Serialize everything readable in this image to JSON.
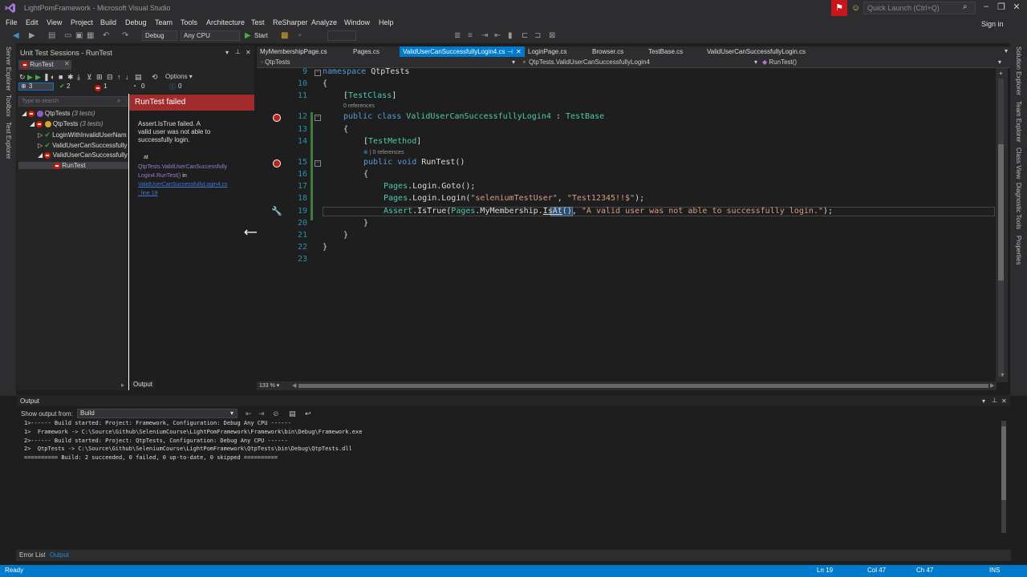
{
  "window": {
    "title": "LightPomFramework - Microsoft Visual Studio",
    "quick_launch_placeholder": "Quick Launch (Ctrl+Q)",
    "sign_in": "Sign in"
  },
  "menu": [
    "File",
    "Edit",
    "View",
    "Project",
    "Build",
    "Debug",
    "Team",
    "Tools",
    "Architecture",
    "Test",
    "ReSharper",
    "Analyze",
    "Window",
    "Help"
  ],
  "toolbar": {
    "configuration": "Debug",
    "platform": "Any CPU",
    "start_label": "Start"
  },
  "left_strip": [
    "Server Explorer",
    "Toolbox",
    "Test Explorer"
  ],
  "right_strip": [
    "Solution Explorer",
    "Team Explorer",
    "Class View",
    "Diagnostic Tools",
    "Properties"
  ],
  "unit_tests": {
    "panel_title": "Unit Test Sessions - RunTest",
    "session_tab": "RunTest",
    "options_label": "Options",
    "counts": {
      "all": "3",
      "passed": "2",
      "failed": "1",
      "ignored": "0",
      "other": "0"
    },
    "filter_placeholder": "Type to search",
    "tree": [
      {
        "label": "QtpTests",
        "suffix": "(3 tests)",
        "status": "fail"
      },
      {
        "label": "QtpTests",
        "suffix": "(3 tests)",
        "status": "fail"
      },
      {
        "label": "LoginWithInvalidUserNam",
        "suffix": "",
        "status": "pass"
      },
      {
        "label": "ValidUserCanSuccessfully",
        "suffix": "",
        "status": "pass"
      },
      {
        "label": "ValidUserCanSuccessfully",
        "suffix": "",
        "status": "fail"
      },
      {
        "label": "RunTest",
        "suffix": "",
        "status": "fail"
      }
    ],
    "detail": {
      "title": "RunTest failed",
      "message": "Assert.IsTrue failed. A\nvalid user was not able to\nsuccessfully login.",
      "at_label": "at",
      "stack_method": "QtpTests.ValidUserCanSuccessfully Login4.RunTest()",
      "stack_in": "in",
      "stack_file": "ValidUserCanSuccessfullyLogin4.cs",
      "stack_line": ": line 19"
    },
    "output_tab": "Output"
  },
  "editor": {
    "tabs": [
      "MyMembershipPage.cs",
      "Pages.cs",
      "ValidUserCanSuccessfullyLogin4.cs",
      "LoginPage.cs",
      "Browser.cs",
      "TestBase.cs",
      "ValidUserCanSuccessfullyLogin.cs"
    ],
    "active_tab_index": 2,
    "nav_project": "QtpTests",
    "nav_class": "QtpTests.ValidUserCanSuccessfullyLogin4",
    "nav_member": "RunTest()",
    "zoom": "133 %",
    "line_numbers": [
      "9",
      "10",
      "11",
      "12",
      "13",
      "14",
      "15",
      "16",
      "17",
      "18",
      "19",
      "20",
      "21",
      "22",
      "23"
    ],
    "refs_class": "0 references",
    "refs_method": "0 references",
    "code": {
      "l9_kw": "namespace",
      "l9_name": " QtpTests",
      "l10": "{",
      "l11_open": "[",
      "l11_attr": "TestClass",
      "l11_close": "]",
      "l12_kw1": "public",
      "l12_kw2": " class",
      "l12_name": " ValidUserCanSuccessfullyLogin4",
      "l12_colon": " : ",
      "l12_base": "TestBase",
      "l13": "{",
      "l14_open": "[",
      "l14_attr": "TestMethod",
      "l14_close": "]",
      "l15_kw1": "public",
      "l15_kw2": " void",
      "l15_name": " RunTest()",
      "l16": "{",
      "l17_a": "Pages",
      "l17_b": ".Login.Goto();",
      "l18_a": "Pages",
      "l18_b": ".Login.Login(",
      "l18_s1": "\"seleniumTestUser\"",
      "l18_c": ", ",
      "l18_s2": "\"Test12345!!$\"",
      "l18_d": ");",
      "l19_a": "Assert",
      "l19_b": ".IsTrue(",
      "l19_c": "Pages",
      "l19_d": ".MyMembership.",
      "l19_e": "IsAt",
      "l19_f": "(), ",
      "l19_s": "\"A valid user was not able to successfully login.\"",
      "l19_g": ");",
      "l20": "}",
      "l21": "}",
      "l22": "}"
    }
  },
  "output": {
    "title": "Output",
    "show_from_label": "Show output from:",
    "show_from_value": "Build",
    "lines": [
      "1>------ Build started: Project: Framework, Configuration: Debug Any CPU ------",
      "1>  Framework -> C:\\Source\\Github\\SeleniumCourse\\LightPomFramework\\Framework\\bin\\Debug\\Framework.exe",
      "2>------ Build started: Project: QtpTests, Configuration: Debug Any CPU ------",
      "2>  QtpTests -> C:\\Source\\Github\\SeleniumCourse\\LightPomFramework\\QtpTests\\bin\\Debug\\QtpTests.dll",
      "========== Build: 2 succeeded, 0 failed, 0 up-to-date, 0 skipped =========="
    ]
  },
  "bottom_tabs": [
    "Error List",
    "Output"
  ],
  "status": {
    "state": "Ready",
    "line": "Ln 19",
    "col": "Col 47",
    "ch": "Ch 47",
    "mode": "INS"
  }
}
